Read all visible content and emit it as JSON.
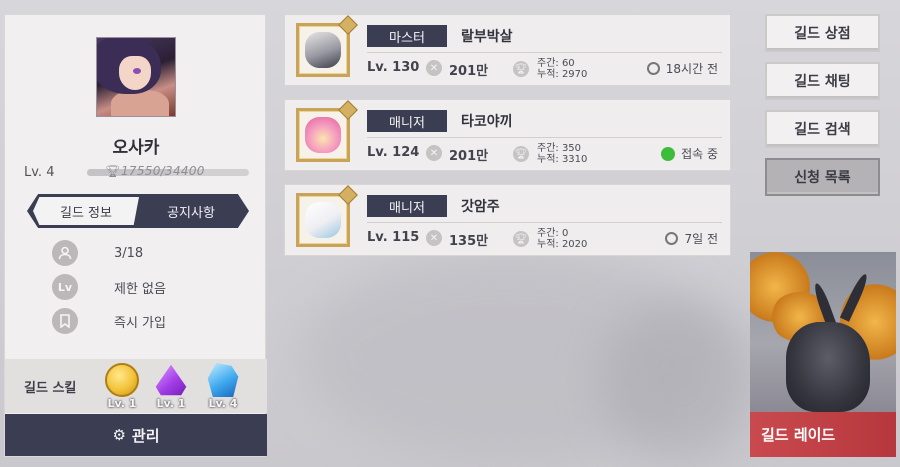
{
  "guild": {
    "name": "오사카",
    "level": "Lv. 4",
    "exp_text": "17550/34400",
    "exp_progress": 0.51,
    "tabs": [
      "길드 정보",
      "공지사항"
    ],
    "info": [
      {
        "icon": "person-icon",
        "text": "3/18"
      },
      {
        "icon": "level-icon",
        "icon_text": "Lv",
        "text": "제한 없음"
      },
      {
        "icon": "bookmark-icon",
        "text": "즉시 가입"
      }
    ],
    "skill_label": "길드 스킬",
    "skills": [
      {
        "icon": "gold-coin-skill-icon",
        "level": "Lv. 1"
      },
      {
        "icon": "purple-crystal-skill-icon",
        "level": "Lv. 1"
      },
      {
        "icon": "blue-crystal-skill-icon",
        "level": "Lv. 4"
      }
    ],
    "manage_label": "관리"
  },
  "members": [
    {
      "role": "마스터",
      "name": "랄부박살",
      "level": "Lv. 130",
      "power": "201만",
      "weekly": "주간: 60",
      "total": "누적: 2970",
      "status": "18시간 전",
      "online": false
    },
    {
      "role": "매니저",
      "name": "타코야끼",
      "level": "Lv. 124",
      "power": "201만",
      "weekly": "주간: 350",
      "total": "누적: 3310",
      "status": "접속 중",
      "online": true
    },
    {
      "role": "매니저",
      "name": "갓암주",
      "level": "Lv. 115",
      "power": "135만",
      "weekly": "주간: 0",
      "total": "누적: 2020",
      "status": "7일 전",
      "online": false
    }
  ],
  "side_menu": [
    "길드 상점",
    "길드 채팅",
    "길드 검색",
    "신청 목록"
  ],
  "raid_label": "길드 레이드",
  "colors": {
    "navy": "#3b3d52",
    "online": "#3dbb3b",
    "raid": "#c94a4e"
  }
}
